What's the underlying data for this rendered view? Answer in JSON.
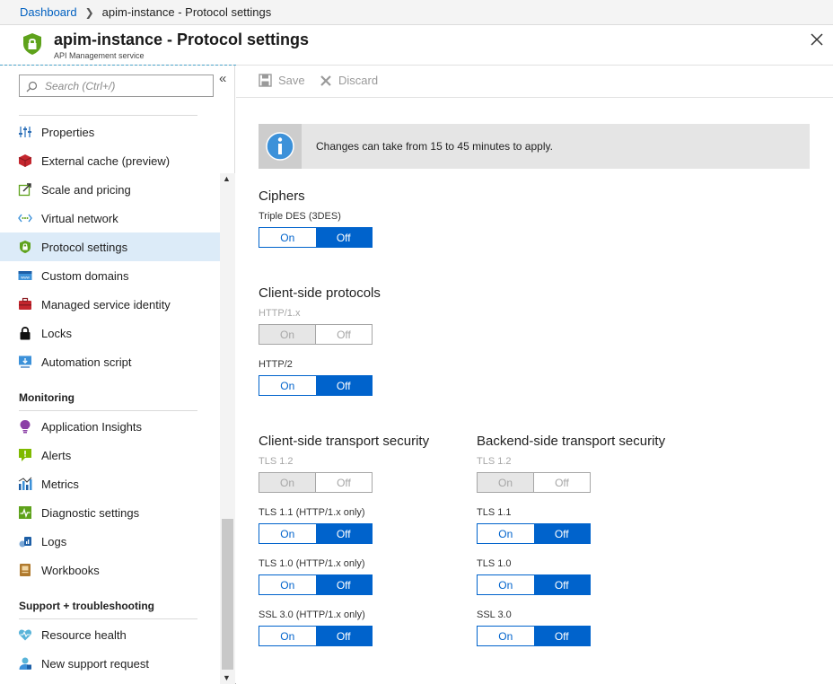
{
  "breadcrumb": {
    "root": "Dashboard",
    "current": "apim-instance - Protocol settings"
  },
  "header": {
    "title": "apim-instance - Protocol settings",
    "subtitle": "API Management service"
  },
  "colors": {
    "accent": "#0063cc",
    "active_nav_bg": "#dcebf8",
    "banner_bg": "#e5e5e5",
    "link": "#0060c0"
  },
  "sidebar": {
    "search_placeholder": "Search (Ctrl+/)",
    "items_top": [
      {
        "label": "Properties",
        "icon": "properties-icon"
      },
      {
        "label": "External cache (preview)",
        "icon": "external-cache-icon"
      },
      {
        "label": "Scale and pricing",
        "icon": "scale-pricing-icon"
      },
      {
        "label": "Virtual network",
        "icon": "virtual-network-icon"
      },
      {
        "label": "Protocol settings",
        "icon": "shield-lock-icon",
        "active": true
      },
      {
        "label": "Custom domains",
        "icon": "custom-domains-icon"
      },
      {
        "label": "Managed service identity",
        "icon": "managed-identity-icon"
      },
      {
        "label": "Locks",
        "icon": "lock-icon"
      },
      {
        "label": "Automation script",
        "icon": "automation-script-icon"
      }
    ],
    "monitoring_header": "Monitoring",
    "monitoring_items": [
      {
        "label": "Application Insights",
        "icon": "app-insights-icon"
      },
      {
        "label": "Alerts",
        "icon": "alerts-icon"
      },
      {
        "label": "Metrics",
        "icon": "metrics-icon"
      },
      {
        "label": "Diagnostic settings",
        "icon": "diagnostic-settings-icon"
      },
      {
        "label": "Logs",
        "icon": "logs-icon"
      },
      {
        "label": "Workbooks",
        "icon": "workbooks-icon"
      }
    ],
    "support_header": "Support + troubleshooting",
    "support_items": [
      {
        "label": "Resource health",
        "icon": "resource-health-icon"
      },
      {
        "label": "New support request",
        "icon": "support-request-icon"
      }
    ]
  },
  "toolbar": {
    "save_label": "Save",
    "discard_label": "Discard"
  },
  "banner": {
    "text": "Changes can take from 15 to 45 minutes to apply."
  },
  "toggle_labels": {
    "on": "On",
    "off": "Off"
  },
  "ciphers": {
    "title": "Ciphers",
    "triple_des": {
      "label": "Triple DES (3DES)",
      "value": "Off",
      "disabled": false
    }
  },
  "client_protocols": {
    "title": "Client-side protocols",
    "http1": {
      "label": "HTTP/1.x",
      "value": "",
      "disabled": true
    },
    "http2": {
      "label": "HTTP/2",
      "value": "Off",
      "disabled": false
    }
  },
  "client_transport": {
    "title": "Client-side transport security",
    "tls12": {
      "label": "TLS 1.2",
      "value": "",
      "disabled": true
    },
    "tls11": {
      "label": "TLS 1.1 (HTTP/1.x only)",
      "value": "Off",
      "disabled": false
    },
    "tls10": {
      "label": "TLS 1.0 (HTTP/1.x only)",
      "value": "Off",
      "disabled": false
    },
    "ssl30": {
      "label": "SSL 3.0 (HTTP/1.x only)",
      "value": "Off",
      "disabled": false
    }
  },
  "backend_transport": {
    "title": "Backend-side transport security",
    "tls12": {
      "label": "TLS 1.2",
      "value": "",
      "disabled": true
    },
    "tls11": {
      "label": "TLS 1.1",
      "value": "Off",
      "disabled": false
    },
    "tls10": {
      "label": "TLS 1.0",
      "value": "Off",
      "disabled": false
    },
    "ssl30": {
      "label": "SSL 3.0",
      "value": "Off",
      "disabled": false
    }
  }
}
